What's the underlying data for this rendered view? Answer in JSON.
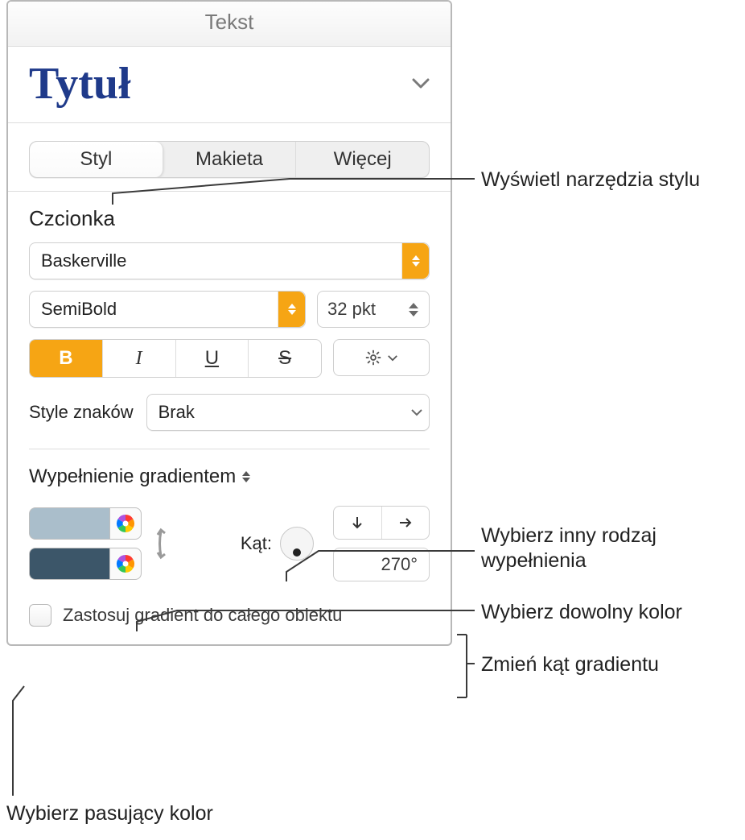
{
  "panel": {
    "title": "Tekst",
    "style_name": "Tytuł",
    "tabs": {
      "style": "Styl",
      "layout": "Makieta",
      "more": "Więcej"
    },
    "font": {
      "section": "Czcionka",
      "family": "Baskerville",
      "weight": "SemiBold",
      "size": "32 pkt",
      "buttons": {
        "bold": "B",
        "italic": "I",
        "underline": "U",
        "strike": "S"
      },
      "char_styles_label": "Style znaków",
      "char_styles_value": "Brak"
    },
    "fill": {
      "label": "Wypełnienie gradientem",
      "angle_label": "Kąt:",
      "angle_value": "270°"
    },
    "apply_label": "Zastosuj gradient do całego obiektu"
  },
  "callouts": {
    "show_style": "Wyświetl narzędzia stylu",
    "pick_fill": "Wybierz inny rodzaj wypełnienia",
    "pick_color": "Wybierz dowolny kolor",
    "change_angle": "Zmień kąt gradientu",
    "matching_color": "Wybierz pasujący kolor"
  }
}
